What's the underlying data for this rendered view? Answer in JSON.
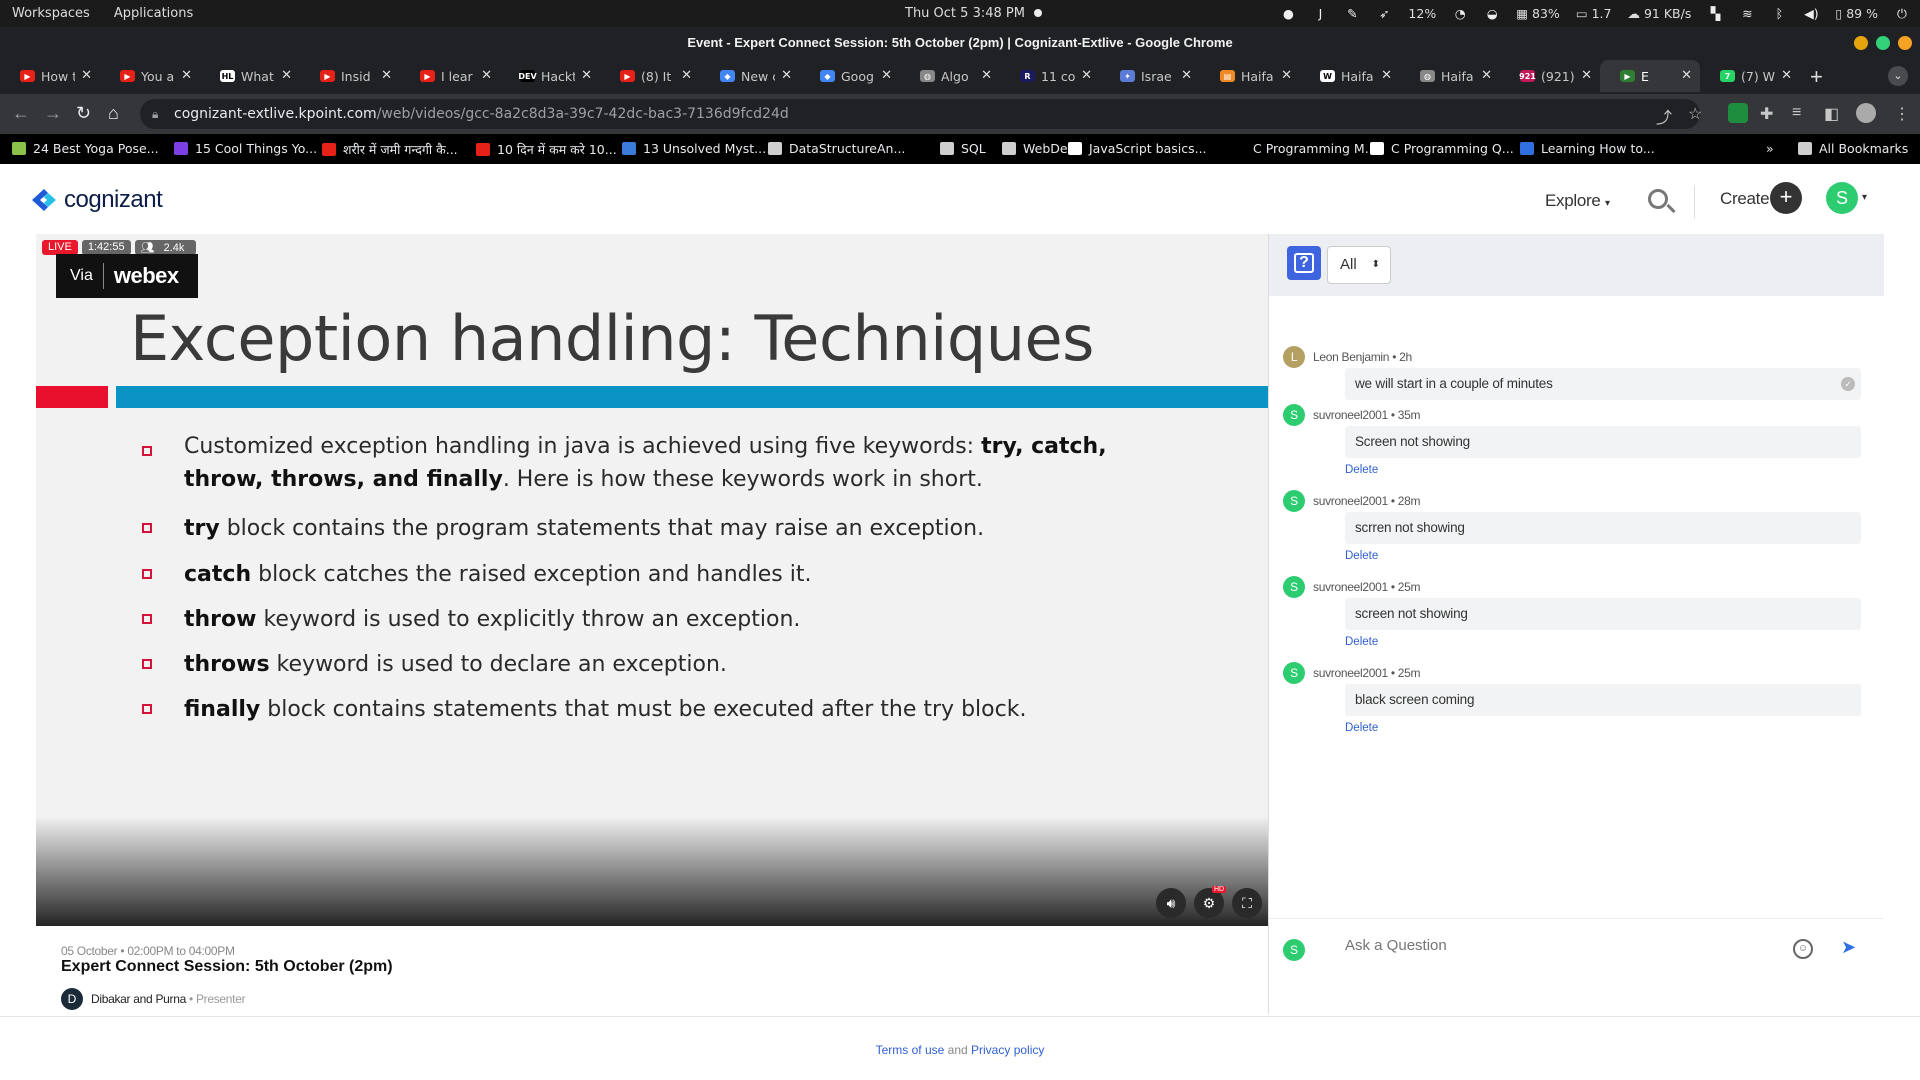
{
  "os": {
    "menu": [
      "Workspaces",
      "Applications"
    ],
    "clock": "Thu Oct 5   3:48 PM",
    "tray": {
      "mem": "83%",
      "load": "1.7",
      "net": "91 KB/s",
      "cpu": "12%",
      "battery": "89 %"
    }
  },
  "window": {
    "title": "Event - Expert Connect Session: 5th October (2pm) | Cognizant-Extlive - Google Chrome"
  },
  "tabs": [
    {
      "label": "How t",
      "color": "#e62117",
      "glyph": "▶"
    },
    {
      "label": "You a",
      "color": "#e62117",
      "glyph": "▶"
    },
    {
      "label": "What",
      "color": "#ffffff",
      "glyph": "HL"
    },
    {
      "label": "Insid",
      "color": "#e62117",
      "glyph": "▶"
    },
    {
      "label": "I lear",
      "color": "#e62117",
      "glyph": "▶"
    },
    {
      "label": "Hackt",
      "color": "#000000",
      "glyph": "DEV"
    },
    {
      "label": "(8) It",
      "color": "#e62117",
      "glyph": "▶"
    },
    {
      "label": "New c",
      "color": "#4285f4",
      "glyph": "◆"
    },
    {
      "label": "Goog",
      "color": "#4285f4",
      "glyph": "◆"
    },
    {
      "label": "Algo",
      "color": "#888888",
      "glyph": "◍"
    },
    {
      "label": "11 co",
      "color": "#1a1a5e",
      "glyph": "R"
    },
    {
      "label": "Israe",
      "color": "#5b7bd6",
      "glyph": "✦"
    },
    {
      "label": "Haifa",
      "color": "#f08a24",
      "glyph": "▤"
    },
    {
      "label": "Haifa",
      "color": "#ffffff",
      "glyph": "W"
    },
    {
      "label": "Haifa",
      "color": "#888888",
      "glyph": "◍"
    },
    {
      "label": "(921)",
      "color": "#c2185b",
      "glyph": "921"
    },
    {
      "label": "E",
      "color": "#2e7d32",
      "glyph": "▶",
      "active": true
    },
    {
      "label": "(7) W",
      "color": "#25d366",
      "glyph": "7"
    }
  ],
  "omnibox": {
    "host": "cognizant-extlive.kpoint.com",
    "path": "/web/videos/gcc-8a2c8d3a-39c7-42dc-bac3-7136d9fcd24d"
  },
  "bookmarks": [
    {
      "label": "24 Best Yoga Pose...",
      "color": "#8bc34a"
    },
    {
      "label": "15 Cool Things Yo...",
      "color": "#7b3fe4"
    },
    {
      "label": "शरीर में जमी गन्दगी कै...",
      "color": "#e62117"
    },
    {
      "label": "10 दिन में कम करे 10...",
      "color": "#e62117"
    },
    {
      "label": "13 Unsolved Myst...",
      "color": "#3b7bd8"
    },
    {
      "label": "DataStructureAn...",
      "color": "#cfcfcf"
    },
    {
      "label": "SQL",
      "color": "#cfcfcf"
    },
    {
      "label": "WebDev",
      "color": "#cfcfcf"
    },
    {
      "label": "JavaScript basics...",
      "color": "#ffffff"
    },
    {
      "label": "C Programming M...",
      "color": "#000000"
    },
    {
      "label": "C Programming Q...",
      "color": "#ffffff"
    },
    {
      "label": "Learning How to...",
      "color": "#2f6fe0"
    },
    {
      "label": "All Bookmarks",
      "color": "#cfcfcf"
    }
  ],
  "site": {
    "logo": "cognizant",
    "explore": "Explore",
    "create": "Create",
    "user_initial": "S"
  },
  "player": {
    "live": "LIVE",
    "elapsed": "1:42:55",
    "viewers": "2.4k",
    "via": "Via",
    "brand": "webex",
    "hd": "HD"
  },
  "slide": {
    "title": "Exception handling: Techniques",
    "intro_a": "Customized exception handling in java is achieved using five keywords: ",
    "intro_b": "try, catch, throw, throws, and finally",
    "intro_c": ". Here is how these keywords work in short.",
    "items": [
      {
        "kw": "try",
        "text": " block contains the program statements that may raise an exception."
      },
      {
        "kw": "catch",
        "text": " block catches the raised exception and handles it."
      },
      {
        "kw": "throw",
        "text": " keyword is used to explicitly throw an exception."
      },
      {
        "kw": "throws",
        "text": " keyword is used to declare an exception."
      },
      {
        "kw": "finally",
        "text": " block contains statements that must be executed after the try block."
      }
    ]
  },
  "event": {
    "date": "05 October • 02:00PM to 04:00PM",
    "title": "Expert Connect Session: 5th October (2pm)",
    "presenter_initial": "D",
    "presenter": "Dibakar and Purna",
    "role": " • Presenter"
  },
  "qa": {
    "filter": "All",
    "messages": [
      {
        "initial": "L",
        "color": "#b5a064",
        "author": "Leon Benjamin • 2h",
        "text": "we will start in a couple of minutes",
        "delete": ""
      },
      {
        "initial": "S",
        "color": "#2ecc71",
        "author": "suvroneel2001 • 35m",
        "text": "Screen not showing",
        "delete": "Delete"
      },
      {
        "initial": "S",
        "color": "#2ecc71",
        "author": "suvroneel2001 • 28m",
        "text": "scrren not showing",
        "delete": "Delete"
      },
      {
        "initial": "S",
        "color": "#2ecc71",
        "author": "suvroneel2001 • 25m",
        "text": "screen not showing",
        "delete": "Delete"
      },
      {
        "initial": "S",
        "color": "#2ecc71",
        "author": "suvroneel2001 • 25m",
        "text": "black screen coming",
        "delete": "Delete"
      }
    ],
    "ask_placeholder": "Ask a Question",
    "user_initial": "S"
  },
  "footer": {
    "terms": "Terms of use",
    "and": " and ",
    "privacy": "Privacy policy"
  }
}
